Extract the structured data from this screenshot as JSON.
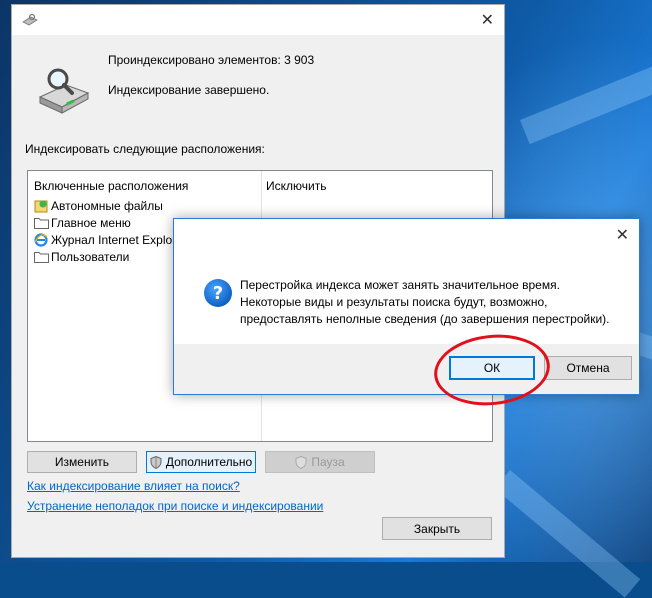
{
  "main_window": {
    "stats": {
      "indexed_items": "Проиндексировано элементов: 3 903",
      "status": "Индексирование завершено."
    },
    "section_label": "Индексировать следующие расположения:",
    "columns": {
      "included": "Включенные расположения",
      "exclude": "Исключить"
    },
    "locations": [
      {
        "label": "Автономные файлы",
        "icon": "offline-files-icon"
      },
      {
        "label": "Главное меню",
        "icon": "folder-icon"
      },
      {
        "label": "Журнал Internet Explorer",
        "icon": "ie-icon"
      },
      {
        "label": "Пользователи",
        "icon": "folder-icon"
      }
    ],
    "buttons": {
      "modify": "Изменить",
      "advanced": "Дополнительно",
      "pause": "Пауза",
      "close": "Закрыть"
    },
    "links": {
      "how_affects": "Как индексирование влияет на поиск?",
      "troubleshoot": "Устранение неполадок при поиске и индексировании"
    }
  },
  "dialog": {
    "message_lines": [
      "Перестройка индекса может занять значительное время.",
      "Некоторые виды и результаты поиска будут, возможно,",
      "предоставлять неполные сведения (до завершения перестройки)."
    ],
    "buttons": {
      "ok": "ОК",
      "cancel": "Отмена"
    },
    "icon": "question-icon"
  },
  "colors": {
    "accent": "#0078d7",
    "link": "#0066cc",
    "highlight": "#e0101c"
  }
}
